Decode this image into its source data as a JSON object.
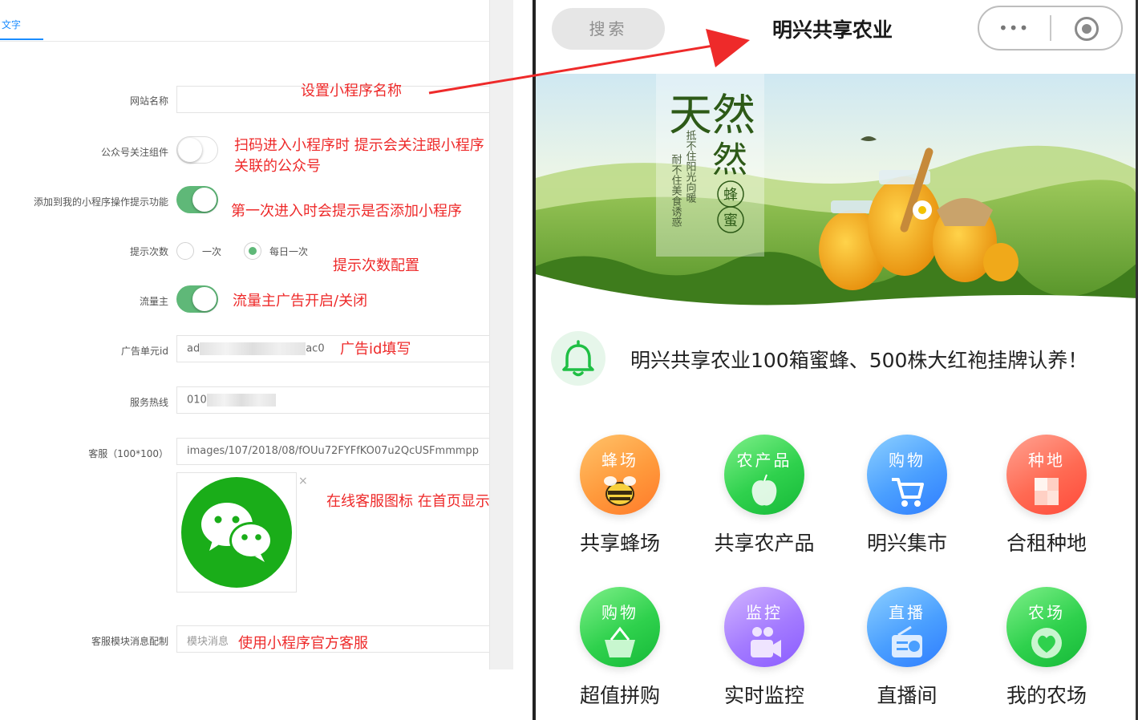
{
  "admin": {
    "tab_label": "文字",
    "fields": {
      "site_name_label": "网站名称",
      "follow_label": "公众号关注组件",
      "add_tip_label": "添加到我的小程序操作提示功能",
      "tip_count_label": "提示次数",
      "tip_once": "一次",
      "tip_daily": "每日一次",
      "traffic_label": "流量主",
      "ad_unit_label": "广告单元id",
      "ad_unit_prefix": "ad",
      "ad_unit_suffix": "ac0",
      "hotline_label": "服务热线",
      "hotline_prefix": "010",
      "service_label": "客服（100*100）",
      "service_value": "images/107/2018/08/fOUu72FYFfKO07u2QcUSFmmmpp",
      "close_glyph": "×",
      "msg_label": "客服模块消息配制",
      "msg_placeholder": "模块消息"
    },
    "toggles": {
      "follow_on": false,
      "add_tip_on": true,
      "traffic_on": true
    },
    "tip_count_selected": "daily"
  },
  "annotations": {
    "set_name": "设置小程序名称",
    "follow_line1": "扫码进入小程序时 提示会关注跟小程序",
    "follow_line2": "关联的公众号",
    "add_tip": "第一次进入时会提示是否添加小程序",
    "tip_count": "提示次数配置",
    "traffic": "流量主广告开启/关闭",
    "ad_id": "广告id填写",
    "service_icon": "在线客服图标 在首页显示",
    "official_service": "使用小程序官方客服"
  },
  "phone": {
    "search_label": "搜索",
    "title": "明兴共享农业",
    "capsule_dots": "•••",
    "banner": {
      "big_text": "天然",
      "sub_text": "蜂蜜",
      "poem_col1": "抵不住阳光向暖",
      "poem_col2": "耐不住美食诱惑"
    },
    "notice": "明兴共享农业100箱蜜蜂、500株大红袍挂牌认养！",
    "menu": [
      {
        "circle": "蜂场",
        "label": "共享蜂场",
        "icon": "bee-icon",
        "color": "#ff9a3c"
      },
      {
        "circle": "农产品",
        "label": "共享农产品",
        "icon": "apple-icon",
        "color": "#2fd14d"
      },
      {
        "circle": "购物",
        "label": "明兴集市",
        "icon": "cart-icon",
        "color": "#4a9fff"
      },
      {
        "circle": "种地",
        "label": "合租种地",
        "icon": "flag-icon",
        "color": "#ff6a53"
      },
      {
        "circle": "购物",
        "label": "超值拼购",
        "icon": "basket-icon",
        "color": "#2fd14d"
      },
      {
        "circle": "监控",
        "label": "实时监控",
        "icon": "camera-icon",
        "color": "#a47bff"
      },
      {
        "circle": "直播",
        "label": "直播间",
        "icon": "radio-icon",
        "color": "#4a9fff"
      },
      {
        "circle": "农场",
        "label": "我的农场",
        "icon": "heart-icon",
        "color": "#2fd14d"
      }
    ]
  }
}
